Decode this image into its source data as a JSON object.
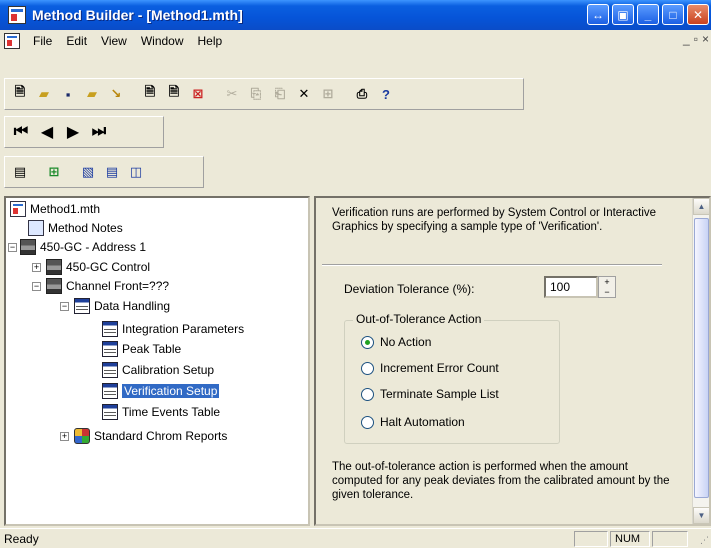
{
  "window": {
    "title": "Method Builder - [Method1.mth]",
    "buttons": [
      "↔",
      "▣",
      "_",
      "□",
      "✕"
    ]
  },
  "menu": {
    "items": [
      "File",
      "Edit",
      "View",
      "Window",
      "Help"
    ],
    "mdi_controls": [
      "_",
      "▫",
      "×"
    ]
  },
  "tree": {
    "nodes": [
      {
        "label": "Method1.mth",
        "icon": "document-icon"
      },
      {
        "label": "Method Notes",
        "icon": "notes-icon"
      },
      {
        "label": "450-GC - Address 1",
        "icon": "gc-instrument-icon"
      },
      {
        "label": "450-GC Control",
        "icon": "gc-instrument-icon"
      },
      {
        "label": "Channel Front=???",
        "icon": "gc-instrument-icon"
      },
      {
        "label": "Data Handling",
        "icon": "table-icon"
      },
      {
        "label": "Integration Parameters",
        "icon": "table-icon"
      },
      {
        "label": "Peak Table",
        "icon": "table-icon"
      },
      {
        "label": "Calibration Setup",
        "icon": "table-icon"
      },
      {
        "label": "Verification Setup",
        "icon": "table-icon",
        "selected": true
      },
      {
        "label": "Time Events Table",
        "icon": "table-icon"
      },
      {
        "label": "Standard Chrom Reports",
        "icon": "report-icon"
      }
    ]
  },
  "panel": {
    "intro": "Verification runs are performed by System Control or Interactive Graphics by specifying a sample type of 'Verification'.",
    "deviation_label": "Deviation Tolerance (%):",
    "deviation_value": "100",
    "group_title": "Out-of-Tolerance Action",
    "options": [
      {
        "label": "No Action",
        "checked": true
      },
      {
        "label": "Increment Error Count",
        "checked": false
      },
      {
        "label": "Terminate Sample List",
        "checked": false
      },
      {
        "label": "Halt Automation",
        "checked": false
      }
    ],
    "footer": "The out-of-tolerance action is performed when the amount computed for any peak deviates from the calibrated amount by the given tolerance."
  },
  "status": {
    "text": "Ready",
    "num": "NUM"
  },
  "colors": {
    "titlebar": "#0654d8",
    "selection": "#316ac5",
    "face": "#ece9d8"
  }
}
